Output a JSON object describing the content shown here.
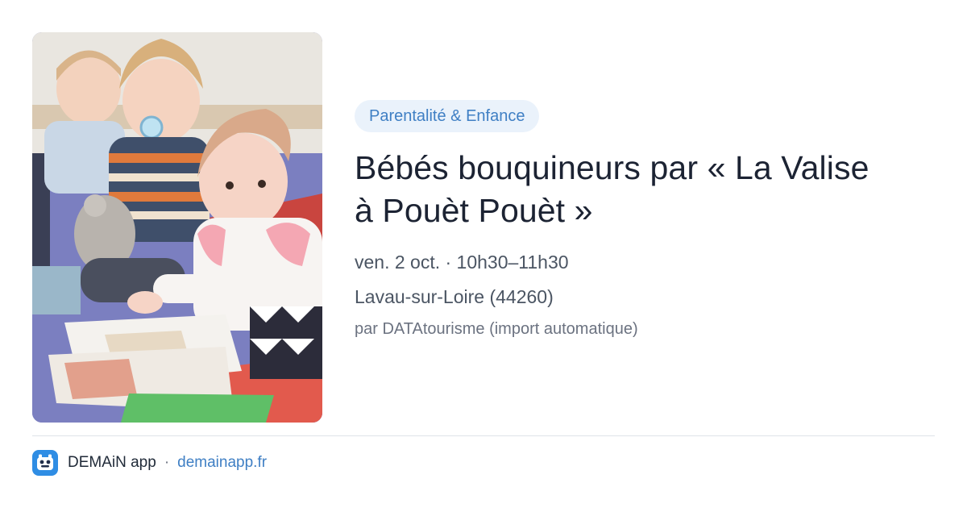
{
  "event": {
    "category": "Parentalité & Enfance",
    "title_line1": "Bébés bouquineurs par « La Valise",
    "title_line2": "à Pouèt Pouèt »",
    "datetime": "ven. 2 oct. · 10h30–11h30",
    "location": "Lavau-sur-Loire (44260)",
    "source": "par DATAtourisme (import automatique)"
  },
  "footer": {
    "icon": "demain-app-icon",
    "app_name": "DEMAiN app",
    "separator": "·",
    "website": "demainapp.fr"
  },
  "colors": {
    "accent": "#3f7fc4",
    "badge_bg": "#eaf2fb",
    "app_icon_bg": "#2f8de4"
  }
}
